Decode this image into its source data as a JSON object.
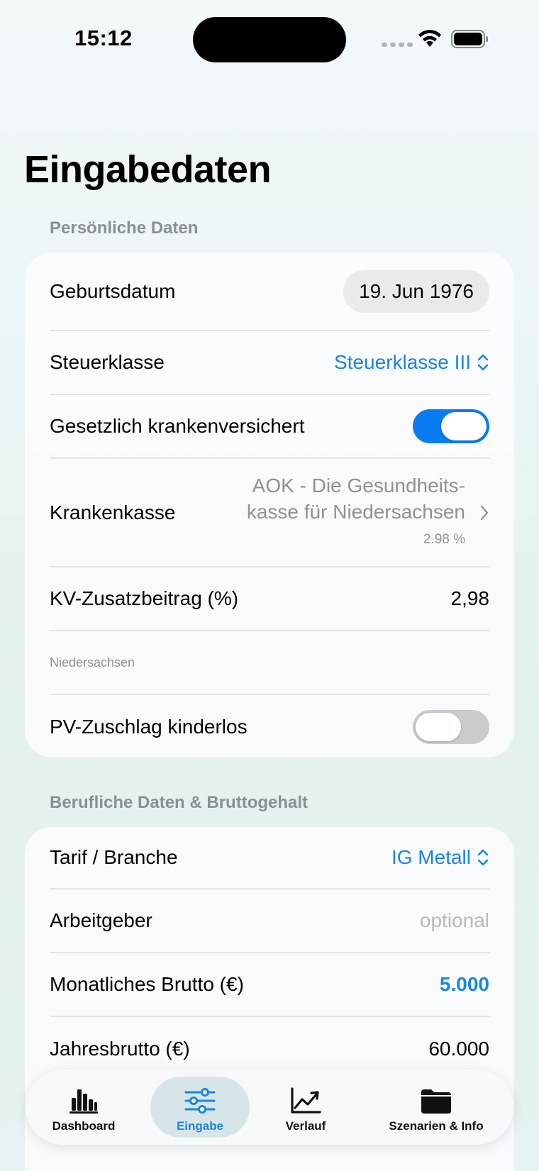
{
  "status_bar": {
    "time": "15:12"
  },
  "page": {
    "title": "Eingabedaten"
  },
  "personal": {
    "header": "Persönliche Daten",
    "birthdate_label": "Geburtsdatum",
    "birthdate_value": "19. Jun 1976",
    "tax_class_label": "Steuerklasse",
    "tax_class_value": "Steuerklasse III",
    "statutory_insured_label": "Gesetzlich krankenversichert",
    "statutory_insured_on": true,
    "insurer_label": "Krankenkasse",
    "insurer_name_line1": "AOK - Die Gesundheits-",
    "insurer_name_line2": "kasse für Niedersachsen",
    "insurer_rate": "2.98 %",
    "kv_additional_label": "KV-Zusatzbeitrag (%)",
    "kv_additional_value": "2,98",
    "state_note": "Niedersachsen",
    "pv_childless_label": "PV-Zuschlag kinderlos",
    "pv_childless_on": false
  },
  "professional": {
    "header": "Berufliche Daten & Bruttogehalt",
    "tariff_label": "Tarif / Branche",
    "tariff_value": "IG Metall",
    "employer_label": "Arbeitgeber",
    "employer_placeholder": "optional",
    "monthly_gross_label": "Monatliches Brutto (€)",
    "monthly_gross_value": "5.000",
    "annual_gross_label": "Jahresbrutto (€)",
    "annual_gross_value": "60.000"
  },
  "tab_bar": {
    "active": "Eingabe",
    "tabs": [
      {
        "label": "Dashboard",
        "icon": "bar-chart-icon"
      },
      {
        "label": "Eingabe",
        "icon": "sliders-icon"
      },
      {
        "label": "Verlauf",
        "icon": "trend-chart-icon"
      },
      {
        "label": "Szenarien & Info",
        "icon": "folder-icon"
      }
    ]
  },
  "colors": {
    "accent": "#1a86e2",
    "toggle_on": "#0a7cf2"
  }
}
